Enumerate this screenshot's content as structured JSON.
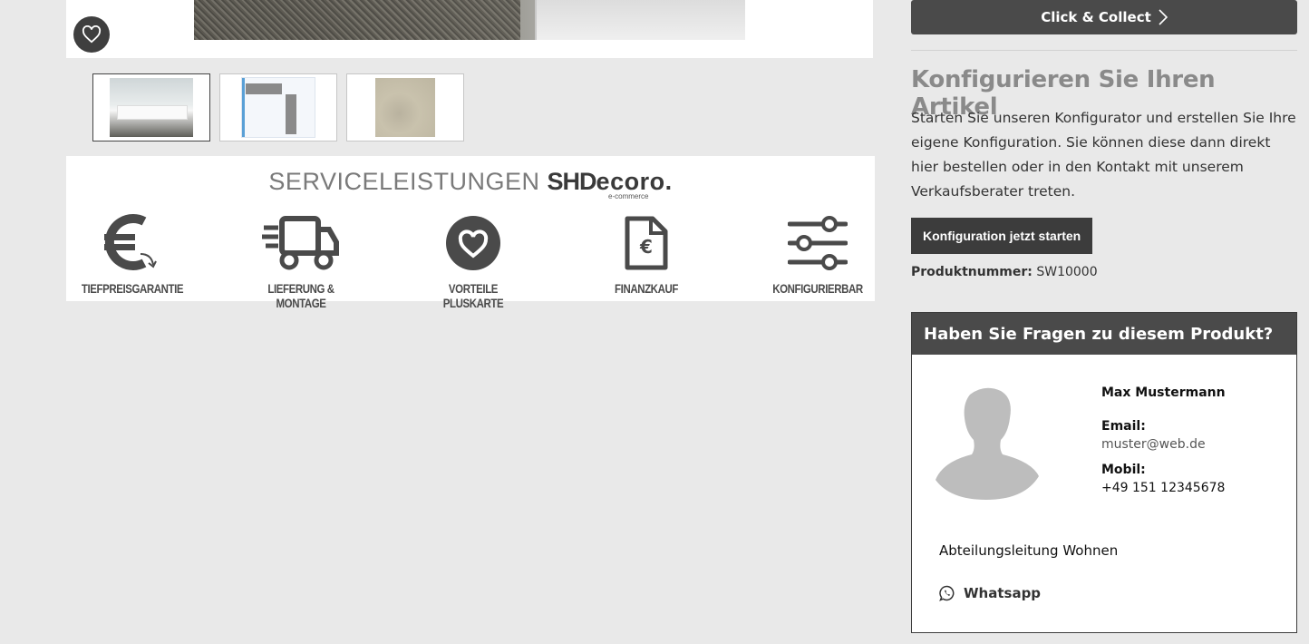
{
  "gallery": {
    "favorite_icon": "heart-icon",
    "thumbnails": [
      {
        "name": "thumbnail-living-room"
      },
      {
        "name": "thumbnail-floorplan"
      },
      {
        "name": "thumbnail-fabric"
      }
    ]
  },
  "services": {
    "title_prefix": "SERVICELEISTUNGEN",
    "brand_shd": "SHD",
    "brand_ecoro": "ecoro.",
    "brand_sub": "e-commerce",
    "items": [
      {
        "label": "TIEFPREISGARANTIE",
        "icon": "euro-icon"
      },
      {
        "label": "LIEFERUNG & MONTAGE",
        "icon": "truck-icon"
      },
      {
        "label": "VORTEILE PLUSKARTE",
        "icon": "heart-circle-icon"
      },
      {
        "label": "FINANZKAUF",
        "icon": "document-euro-icon"
      },
      {
        "label": "KONFIGURIERBAR",
        "icon": "sliders-icon"
      }
    ]
  },
  "sidebar": {
    "click_collect_label": "Click & Collect",
    "configure_title": "Konfigurieren Sie Ihren Artikel",
    "configure_text": "Starten Sie unseren Konfigurator und erstellen Sie Ihre eigene Konfiguration. Sie können diese dann direkt hier bestellen oder in den Kontakt mit unserem Verkaufsberater treten.",
    "configure_button": "Konfiguration jetzt starten",
    "product_number_label": "Produktnummer:",
    "product_number_value": "SW10000"
  },
  "contact": {
    "heading": "Haben Sie Fragen zu diesem Produkt?",
    "name": "Max Mustermann",
    "email_label": "Email:",
    "email": "muster@web.de",
    "mobile_label": "Mobil:",
    "mobile": "+49 151 12345678",
    "department": "Abteilungsleitung Wohnen",
    "whatsapp_label": "Whatsapp"
  },
  "colors": {
    "page_bg": "#e9e9e9",
    "dark_button": "#4a4a4a",
    "heading_gray": "#8a8a8a"
  }
}
